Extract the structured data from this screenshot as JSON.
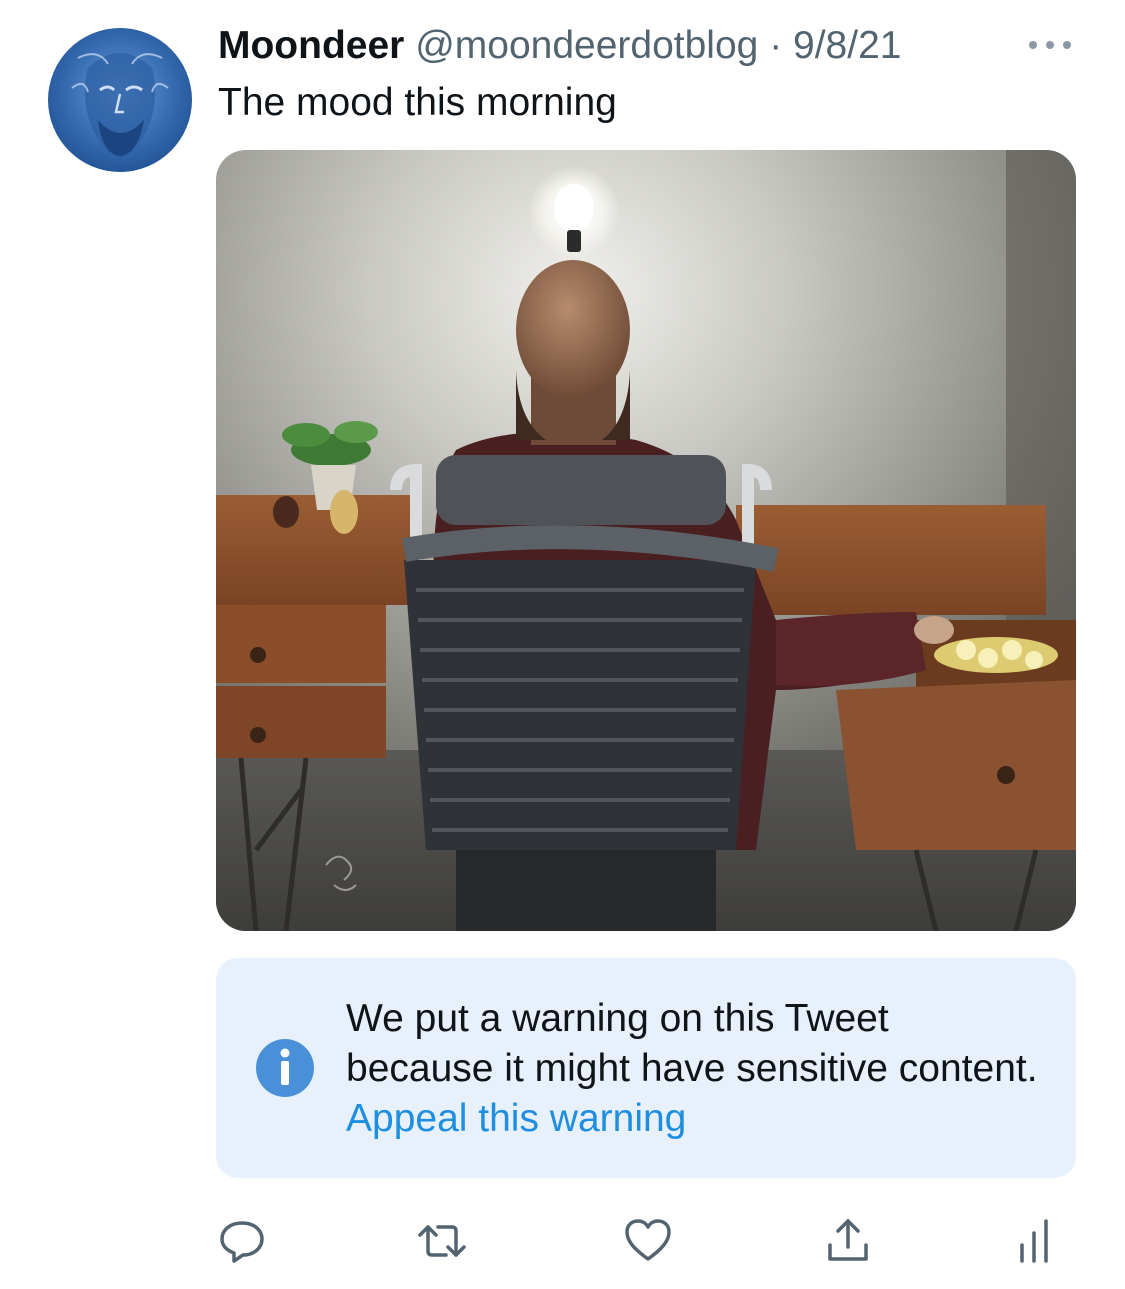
{
  "tweet": {
    "author_name": "Moondeer",
    "handle": "@moondeerdotblog",
    "separator": "·",
    "date": "9/8/21",
    "text": "The mood this morning"
  },
  "warning": {
    "message": "We put a warning on this Tweet because it might have sensitive content.",
    "appeal_label": "Appeal this warning"
  },
  "icons": {
    "more": "more-horizontal-icon",
    "info": "info-icon",
    "reply": "reply-bubble-icon",
    "retweet": "retweet-icon",
    "like": "heart-icon",
    "share": "share-upload-icon",
    "analytics": "analytics-bars-icon"
  },
  "colors": {
    "text": "#0f1419",
    "secondary": "#536471",
    "link": "#1d8ee0",
    "warning_bg": "#e8f1fb",
    "info_icon": "#4a90d9"
  }
}
